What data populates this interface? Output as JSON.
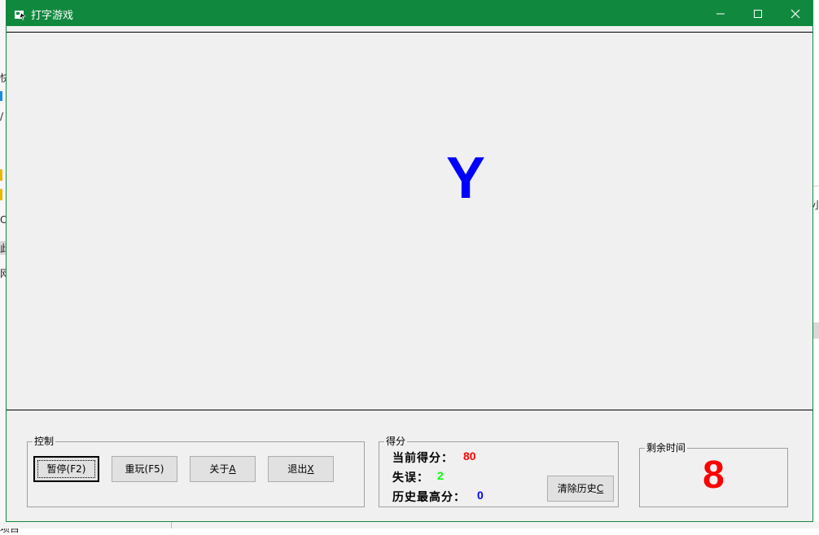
{
  "window": {
    "title": "打字游戏",
    "titlebar_color": "#10893e",
    "icons": {
      "app": "app-icon",
      "minimize": "minimize-icon",
      "maximize": "maximize-icon",
      "close": "close-icon"
    }
  },
  "game": {
    "current_letter": "Y",
    "letter_color": "#0000ff"
  },
  "control": {
    "title": "控制",
    "pause_label": "暂停(F2)",
    "replay_label": "重玩(F5)",
    "about_label_prefix": "关于",
    "about_hotkey": "A",
    "exit_label_prefix": "退出",
    "exit_hotkey": "X"
  },
  "score": {
    "title": "得分",
    "current_label": "当前得分：",
    "current_value": "80",
    "current_color": "#ff0000",
    "errors_label": "失误：",
    "errors_value": "2",
    "errors_color": "#00ff00",
    "best_label": "历史最高分：",
    "best_value": "0",
    "best_color": "#0000ff",
    "clear_label_prefix": "清除历史",
    "clear_hotkey": "C"
  },
  "timer": {
    "title": "剩余时间",
    "value": "8",
    "color": "#ff0000"
  },
  "background": {
    "left_chars": [
      "快",
      "/",
      "C",
      "此",
      "网",
      "项目"
    ],
    "right_chars": [
      "小"
    ]
  }
}
